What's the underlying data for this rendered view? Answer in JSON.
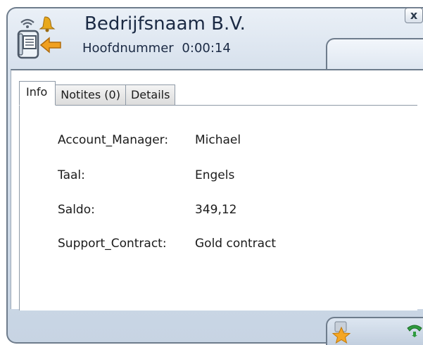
{
  "caller": {
    "company_name": "Bedrijfsnaam B.V.",
    "line_name": "Hoofdnummer",
    "duration": "0:00:14"
  },
  "window": {
    "close_label": "x"
  },
  "tabs": [
    {
      "label": "Info",
      "active": true
    },
    {
      "label": "Notites (0)",
      "active": false
    },
    {
      "label": "Details",
      "active": false
    }
  ],
  "info": {
    "rows": [
      {
        "key": "Account_Manager:",
        "value": "Michael"
      },
      {
        "key": "Taal:",
        "value": "Engels"
      },
      {
        "key": "Saldo:",
        "value": "349,12"
      },
      {
        "key": "Support_Contract:",
        "value": "Gold contract"
      }
    ]
  },
  "icons": {
    "caller": "phone-device-icon",
    "ringing": "bell-icon",
    "wireless": "wireless-icon",
    "incoming": "incoming-arrow-icon",
    "favorite": "star-icon",
    "call": "phone-handset-icon"
  },
  "colors": {
    "window_border": "#6e7c8c",
    "header_background": "#d6e0ec",
    "text": "#1b2a44",
    "arrow": "#f0a020",
    "bell": "#e8a81c",
    "star": "#f5a623",
    "phone_green": "#2e9b3e"
  }
}
